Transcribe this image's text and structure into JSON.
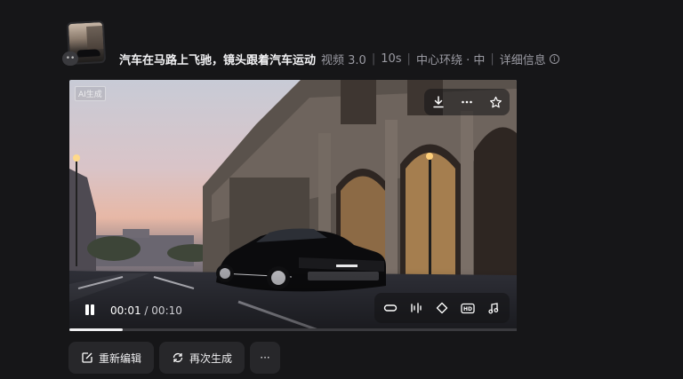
{
  "header": {
    "title": "汽车在马路上飞驰，镜头跟着汽车运动",
    "model": "视频 3.0",
    "duration": "10s",
    "camera": "中心环绕 · 中",
    "details_label": "详细信息",
    "thumb_badge": "••"
  },
  "video": {
    "ai_tag": "AI生成",
    "current_time": "00:01",
    "time_separator": "/",
    "total_time": "00:10",
    "progress": 0.12,
    "top_tools": [
      {
        "icon": "download-icon"
      },
      {
        "icon": "more-icon"
      },
      {
        "icon": "star-icon"
      }
    ],
    "bottom_tools": [
      {
        "icon": "loop-icon"
      },
      {
        "icon": "audio-adjust-icon"
      },
      {
        "icon": "enhance-icon"
      },
      {
        "icon": "hd-icon",
        "label": "HD"
      },
      {
        "icon": "music-icon"
      }
    ]
  },
  "actions": {
    "reedit_label": "重新编辑",
    "regenerate_label": "再次生成",
    "more_label": "···"
  },
  "colors": {
    "background": "#161618",
    "button_bg": "#27272a",
    "text": "#f2f2f4",
    "muted": "#9a9aa2"
  }
}
